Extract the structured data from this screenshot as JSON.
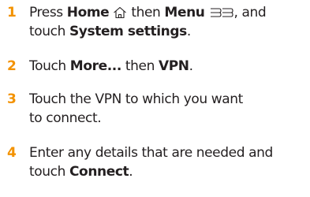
{
  "steps": [
    {
      "number": "1",
      "line1": {
        "t1": "Press ",
        "b1": "Home",
        "home_icon": "home-icon",
        "t2": " then ",
        "b2": "Menu",
        "menu_icon": "menu-icon",
        "t3": ", and"
      },
      "line2": {
        "t1": "touch ",
        "b1": "System settings",
        "t2": "."
      }
    },
    {
      "number": "2",
      "line1": {
        "t1": "Touch ",
        "b1": "More...",
        "t2": " then ",
        "b2": "VPN",
        "t3": "."
      }
    },
    {
      "number": "3",
      "line1": "Touch the VPN to which you want",
      "line2": "to connect."
    },
    {
      "number": "4",
      "line1": "Enter any details that are needed and",
      "line2": {
        "t1": "touch ",
        "b1": "Connect",
        "t2": "."
      }
    }
  ],
  "colors": {
    "accent": "#f39200",
    "text": "#231f20"
  }
}
